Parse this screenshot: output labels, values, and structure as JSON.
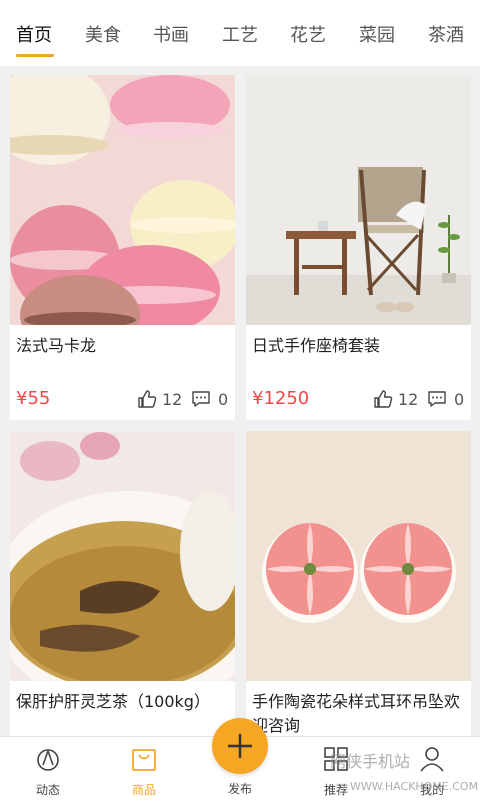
{
  "tabs": [
    {
      "label": "首页",
      "active": true
    },
    {
      "label": "美食"
    },
    {
      "label": "书画"
    },
    {
      "label": "工艺"
    },
    {
      "label": "花艺"
    },
    {
      "label": "菜园"
    },
    {
      "label": "茶酒"
    }
  ],
  "products": [
    {
      "title": "法式马卡龙",
      "price": "¥55",
      "likes": "12",
      "comments": "0",
      "image": "macarons"
    },
    {
      "title": "日式手作座椅套装",
      "price": "¥1250",
      "likes": "12",
      "comments": "0",
      "image": "chair-set"
    },
    {
      "title": "保肝护肝灵芝茶（100kg）",
      "image": "tea-cup"
    },
    {
      "title": "手作陶瓷花朵样式耳环吊坠欢",
      "title_line2": "迎咨询",
      "image": "ceramic-earrings"
    }
  ],
  "bottom_nav": {
    "dynamics": "动态",
    "goods": "商品",
    "publish": "发布",
    "recommend": "推荐",
    "mine": "我的"
  },
  "watermark": {
    "brand": "网侠手机站",
    "url": "WWW.HACKHOME.COM"
  },
  "colors": {
    "accent": "#f5a623",
    "price": "#f04848"
  }
}
